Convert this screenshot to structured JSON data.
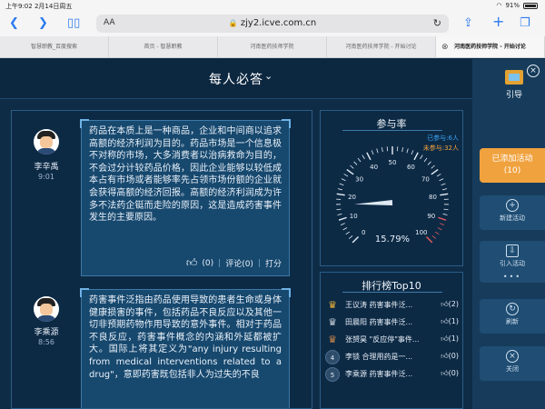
{
  "status_bar": {
    "time": "上午9:02",
    "date": "2月14日周五",
    "battery": "91%"
  },
  "browser": {
    "text_size_label": "AA",
    "url": "zjy2.icve.com.cn",
    "tabs": [
      {
        "label": "智慧职教_百度搜索",
        "active": false
      },
      {
        "label": "首页 - 智慧职教",
        "active": false
      },
      {
        "label": "河南医药技师学院",
        "active": false
      },
      {
        "label": "河南医药技师学院 - 开始讨论",
        "active": false
      },
      {
        "label": "河南医药技师学院 - 开始讨论",
        "active": true
      }
    ]
  },
  "page": {
    "title": "每人必答",
    "title_chevron": "chevron-down-icon"
  },
  "posts": [
    {
      "user": "李辛禹",
      "time": "9:01",
      "text": "药品在本质上是一种商品，企业和中间商以追求高额的经济利润为目的。药品市场是一个信息极不对称的市场，大多消费者以治病救命为目的，不会过分计较药品价格，因此企业能够以较低成本占有市场或者能够率先占领市场份额的企业就会获得高额的经济回报。高额的经济利润成为许多不法药企铤而走险的原因，这是造成药害事件发生的主要原因。",
      "likes": "(0)",
      "comments": "评论(0)",
      "score": "打分"
    },
    {
      "user": "李乘源",
      "time": "8:56",
      "text": "药害事件泛指由药品使用导致的患者生命或身体健康损害的事件，包括药品不良反应以及其他一切非预期药物作用导致的意外事件。相对于药品不良反应，药害事件概念的内涵和外延都被扩大。国际上将其定义为\"any injury resulting from medical interventions related to a drug\"，意即药害既包括非人为过失的不良",
      "likes": "",
      "comments": "",
      "score": ""
    }
  ],
  "participation": {
    "title": "参与率",
    "participated": "已参与:6人",
    "not_participated": "未参与:32人",
    "rate": "15.79%",
    "rate_value": 15.79,
    "ticks": [
      "0",
      "10",
      "20",
      "30",
      "40",
      "50",
      "60",
      "70",
      "80",
      "90",
      "100"
    ]
  },
  "ranking": {
    "title": "排行榜Top10",
    "rows": [
      {
        "rank": "1",
        "badge": "gold-crown-icon",
        "text": "王议涛  药害事件泛...",
        "likes": "(2)"
      },
      {
        "rank": "2",
        "badge": "silver-crown-icon",
        "text": "田晨阳  药害事件泛...",
        "likes": "(1)"
      },
      {
        "rank": "3",
        "badge": "bronze-crown-icon",
        "text": "张赟昊  \"反应停\"事件...",
        "likes": "(1)"
      },
      {
        "rank": "4",
        "badge": "rank-number",
        "text": "李锁  合理用药是一...",
        "likes": "(0)"
      },
      {
        "rank": "5",
        "badge": "rank-number",
        "text": "李乘源  药害事件泛...",
        "likes": "(0)"
      }
    ]
  },
  "sidebar": {
    "guide": "引导",
    "added_activity": "已添加活动",
    "added_count": "(10)",
    "new_activity": "新建活动",
    "import_activity": "引入活动",
    "refresh": "刷新",
    "close": "关闭"
  },
  "colors": {
    "accent_orange": "#f0a23e",
    "accent_blue": "#39a3f2",
    "panel_bg": "#0d2a45",
    "card_bg": "#17486e"
  }
}
